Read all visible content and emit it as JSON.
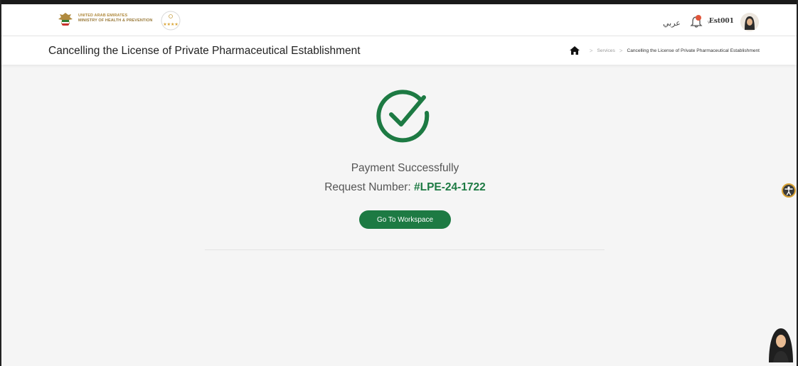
{
  "header": {
    "ministry_line1": "UNITED ARAB EMIRATES",
    "ministry_line2": "MINISTRY OF HEALTH & PREVENTION",
    "language_link": "عربي",
    "username": "Est001"
  },
  "titlebar": {
    "page_title": "Cancelling the License of Private Pharmaceutical Establishment",
    "breadcrumb": {
      "services": "Services",
      "current": "Cancelling the License of Private Pharmaceutical Establishment"
    }
  },
  "main": {
    "status_message": "Payment Successfully",
    "request_label": "Request Number:",
    "request_number": "#LPE-24-1722",
    "workspace_button": "Go To Workspace"
  },
  "colors": {
    "accent_green": "#1d7a43",
    "gold": "#b08a3e"
  },
  "icons": [
    "uae-emblem-icon",
    "star-rating-badge-icon",
    "bell-icon",
    "user-avatar-icon",
    "home-icon",
    "success-check-icon",
    "accessibility-icon",
    "chat-assistant-icon"
  ]
}
